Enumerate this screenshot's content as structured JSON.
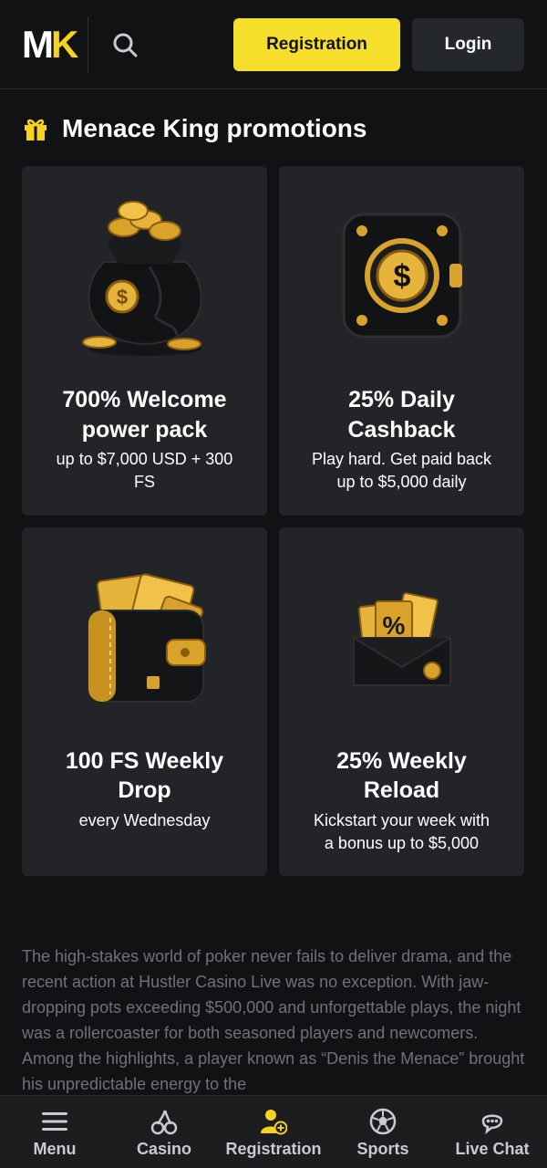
{
  "header": {
    "logo_m": "M",
    "logo_k": "K",
    "registration_label": "Registration",
    "login_label": "Login",
    "accent": "#f6df2a"
  },
  "section": {
    "title": "Menace King promotions"
  },
  "promotions": [
    {
      "title_line1": "700% Welcome",
      "title_line2": "power pack",
      "desc_line1": "up to $7,000 USD + 300",
      "desc_line2": "FS",
      "icon": "coin-bag-icon"
    },
    {
      "title_line1": "25% Daily",
      "title_line2": "Cashback",
      "desc_line1": "Play hard. Get paid back",
      "desc_line2": "up to $5,000 daily",
      "icon": "safe-icon"
    },
    {
      "title_line1": "100 FS Weekly",
      "title_line2": "Drop",
      "desc_line1": "every Wednesday",
      "desc_line2": "",
      "icon": "wallet-icon"
    },
    {
      "title_line1": "25% Weekly",
      "title_line2": "Reload",
      "desc_line1": "Kickstart your week with",
      "desc_line2": "a bonus up to $5,000",
      "icon": "envelope-icon"
    }
  ],
  "article": {
    "text": "The high-stakes world of poker never fails to deliver drama, and the recent action at Hustler Casino Live was no exception. With jaw-dropping pots exceeding $500,000 and unforgettable plays, the night was a rollercoaster for both seasoned players and newcomers. Among the highlights, a player known as “Denis the Menace” brought his unpredictable energy to the"
  },
  "bottom_nav": [
    {
      "label": "Menu",
      "icon": "menu-icon"
    },
    {
      "label": "Casino",
      "icon": "cherries-icon"
    },
    {
      "label": "Registration",
      "icon": "add-user-icon"
    },
    {
      "label": "Sports",
      "icon": "soccer-ball-icon"
    },
    {
      "label": "Live Chat",
      "icon": "chat-icon"
    }
  ]
}
